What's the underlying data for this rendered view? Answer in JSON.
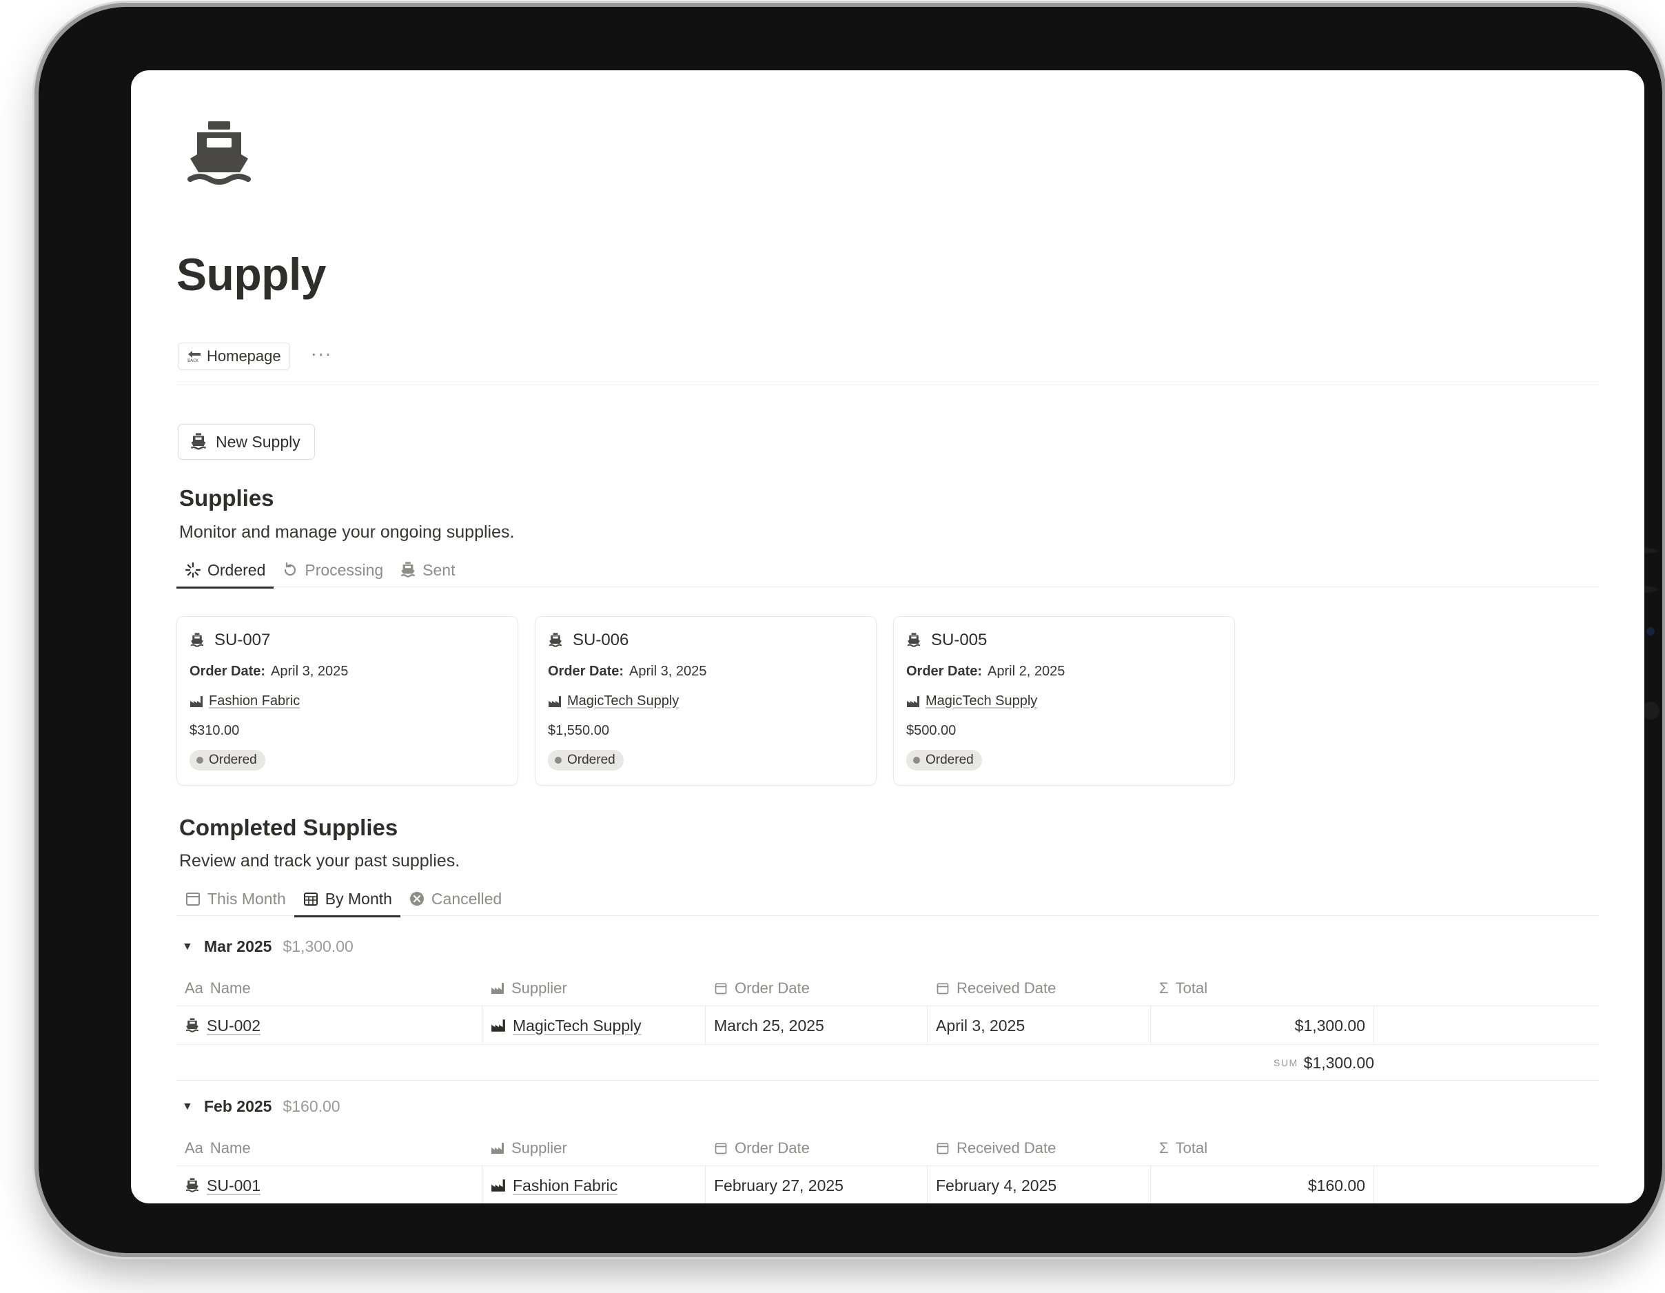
{
  "page": {
    "icon": "ship-icon",
    "title": "Supply",
    "breadcrumb": {
      "label": "Homepage",
      "icon": "back-sign-icon",
      "more": "···"
    },
    "new_button": "New Supply"
  },
  "supplies": {
    "heading": "Supplies",
    "description": "Monitor and manage your ongoing supplies.",
    "tabs": [
      {
        "label": "Ordered",
        "icon": "spinner-icon",
        "active": true
      },
      {
        "label": "Processing",
        "icon": "rotate-icon",
        "active": false
      },
      {
        "label": "Sent",
        "icon": "ship-icon",
        "active": false
      }
    ],
    "cards": [
      {
        "id": "SU-007",
        "order_date_label": "Order Date:",
        "order_date": "April 3, 2025",
        "supplier": "Fashion Fabric",
        "amount": "$310.00",
        "status": "Ordered"
      },
      {
        "id": "SU-006",
        "order_date_label": "Order Date:",
        "order_date": "April 3, 2025",
        "supplier": "MagicTech Supply",
        "amount": "$1,550.00",
        "status": "Ordered"
      },
      {
        "id": "SU-005",
        "order_date_label": "Order Date:",
        "order_date": "April 2, 2025",
        "supplier": "MagicTech Supply",
        "amount": "$500.00",
        "status": "Ordered"
      }
    ]
  },
  "completed": {
    "heading": "Completed Supplies",
    "description": "Review and track your past supplies.",
    "tabs": [
      {
        "label": "This Month",
        "icon": "calendar-icon",
        "active": false
      },
      {
        "label": "By Month",
        "icon": "calendar-grid-icon",
        "active": true
      },
      {
        "label": "Cancelled",
        "icon": "x-circle-icon",
        "active": false
      }
    ],
    "columns": [
      {
        "label": "Name",
        "prefix": "Aa"
      },
      {
        "label": "Supplier",
        "icon": "factory-icon"
      },
      {
        "label": "Order Date",
        "icon": "calendar-icon"
      },
      {
        "label": "Received Date",
        "icon": "calendar-icon"
      },
      {
        "label": "Total",
        "prefix": "Σ"
      }
    ],
    "groups": [
      {
        "name": "Mar 2025",
        "sum": "$1,300.00",
        "rows": [
          {
            "name": "SU-002",
            "supplier": "MagicTech Supply",
            "order_date": "March 25, 2025",
            "received_date": "April 3, 2025",
            "total": "$1,300.00"
          }
        ],
        "footer_label": "SUM",
        "footer_value": "$1,300.00"
      },
      {
        "name": "Feb 2025",
        "sum": "$160.00",
        "rows": [
          {
            "name": "SU-001",
            "supplier": "Fashion Fabric",
            "order_date": "February 27, 2025",
            "received_date": "February 4, 2025",
            "total": "$160.00"
          }
        ]
      }
    ]
  },
  "colors": {
    "text": "#37352f",
    "muted": "#8e8c86",
    "border": "#ebeae6",
    "pill": "#e8e7e4",
    "frame": "#111111"
  }
}
